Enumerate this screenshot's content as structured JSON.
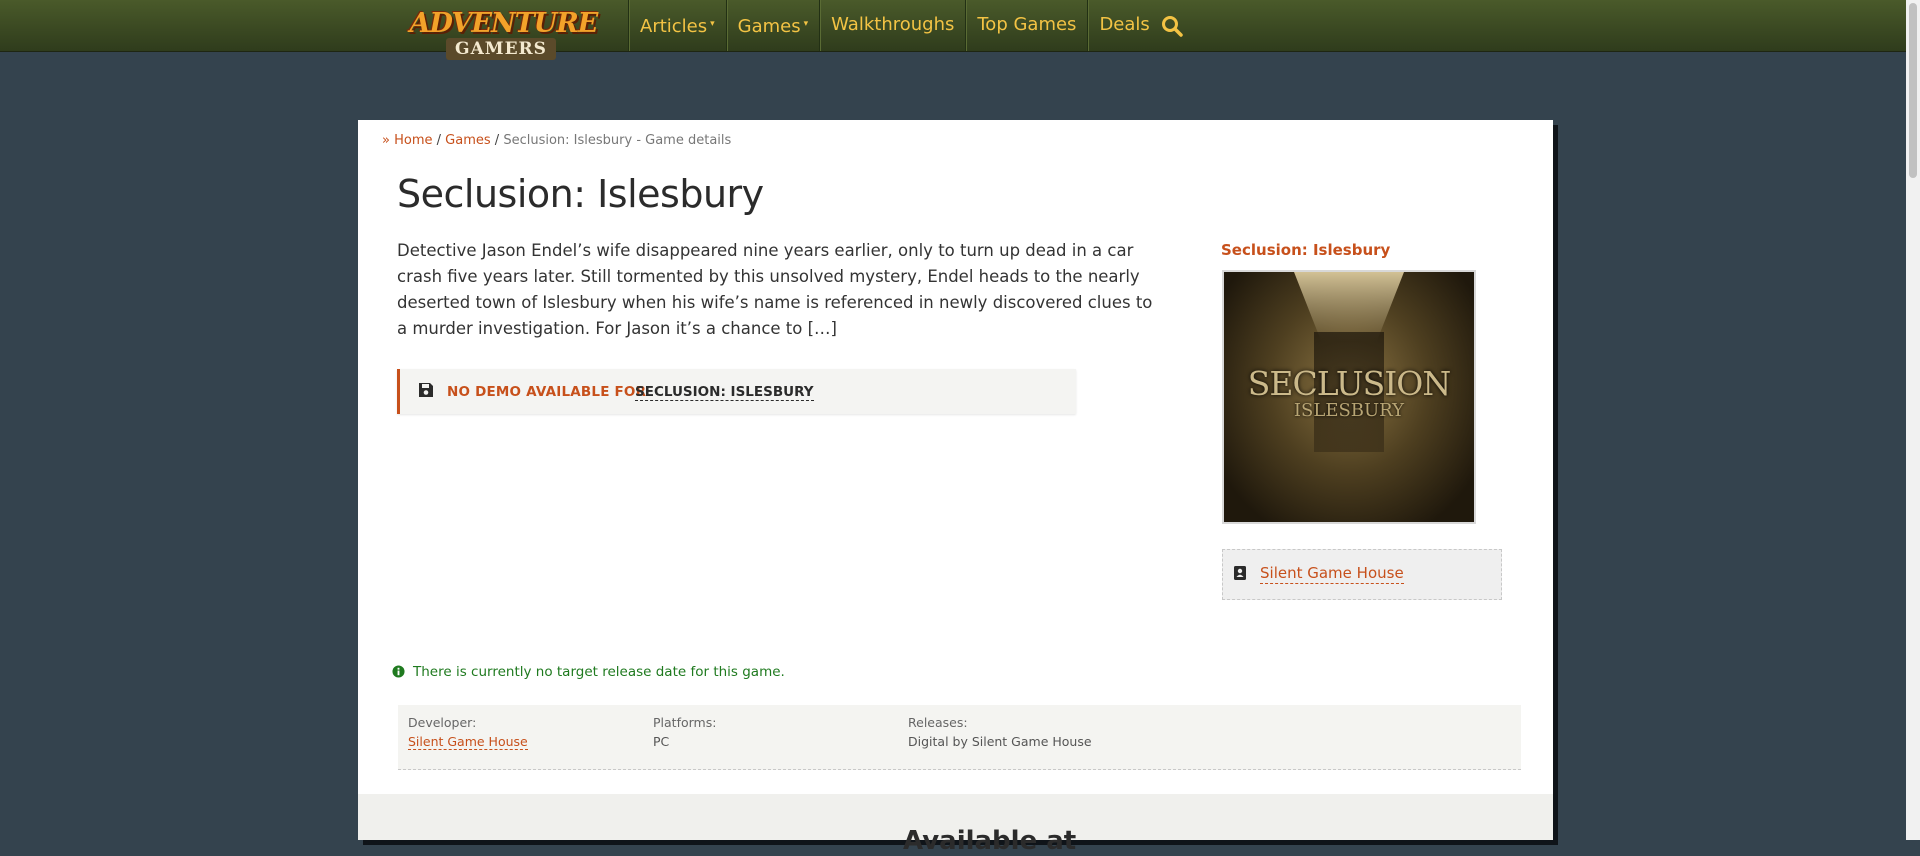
{
  "brand": {
    "logo_top": "ADVENTURE",
    "logo_bottom": "GAMERS"
  },
  "nav": {
    "items": [
      {
        "label": "Articles",
        "dropdown": true
      },
      {
        "label": "Games",
        "dropdown": true
      },
      {
        "label": "Walkthroughs",
        "dropdown": false
      },
      {
        "label": "Top Games",
        "dropdown": false
      },
      {
        "label": "Deals",
        "dropdown": false
      }
    ],
    "search_icon": "search-icon"
  },
  "breadcrumb": {
    "prefix": "»",
    "home": "Home",
    "games": "Games",
    "separator": "/",
    "current": "Seclusion: Islesbury - Game details"
  },
  "game": {
    "title": "Seclusion: Islesbury",
    "description": "Detective Jason Endel’s wife disappeared nine years earlier, only to turn up dead in a car crash five years later. Still tormented by this unsolved mystery, Endel heads to the nearly deserted town of Islesbury when his wife’s name is referenced in newly discovered clues to a murder investigation. For Jason it’s a chance to […]"
  },
  "demo": {
    "label": "NO DEMO AVAILABLE FOR",
    "game": "SECLUSION: ISLESBURY",
    "icon": "floppy-disk-icon"
  },
  "sidebar": {
    "title": "Seclusion: Islesbury",
    "cover_title": "SECLUSION",
    "cover_subtitle": "ISLESBURY",
    "developer_link": "Silent Game House",
    "developer_icon": "contact-card-icon"
  },
  "notice": {
    "text": "There is currently no target release date for this game.",
    "icon": "info-circle-icon"
  },
  "info": {
    "developer_label": "Developer:",
    "developer_value": "Silent Game House",
    "platforms_label": "Platforms:",
    "platforms_value": "PC",
    "releases_label": "Releases:",
    "releases_value": "Digital by Silent Game House"
  },
  "bottom": {
    "heading": "Available at"
  },
  "colors": {
    "accent": "#c7501b",
    "nav_text": "#f3c344",
    "page_bg": "#34434e",
    "notice": "#1f7a1f"
  }
}
